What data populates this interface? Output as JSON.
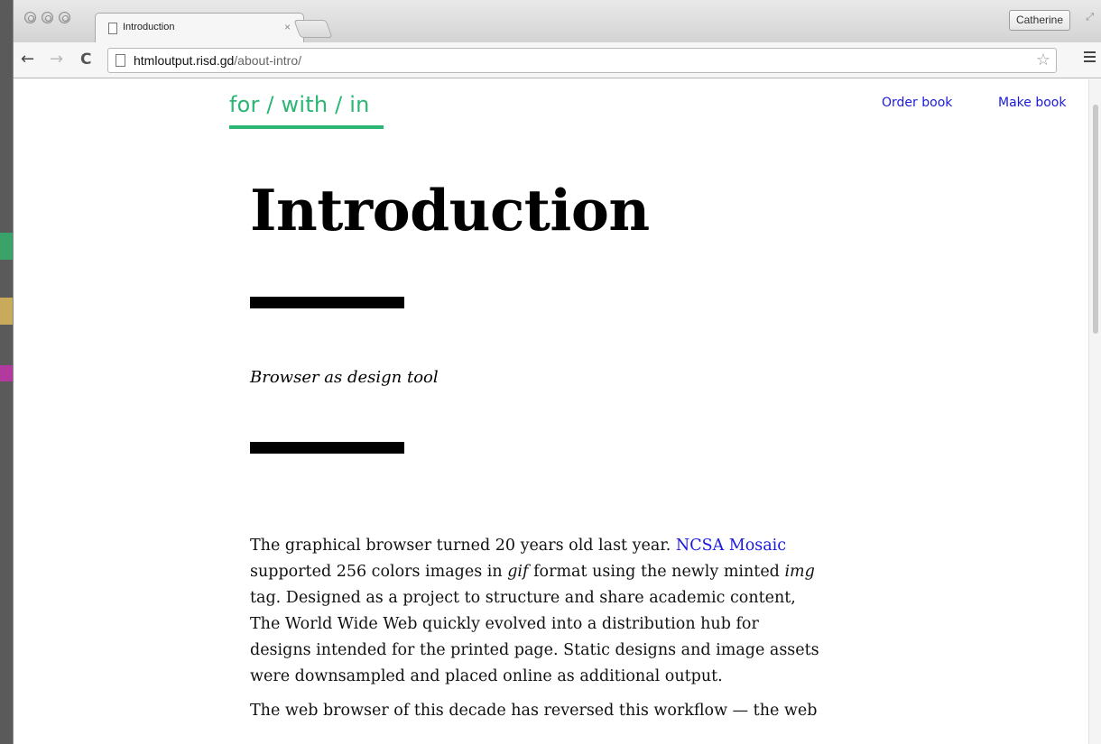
{
  "browser": {
    "tab_title": "Introduction",
    "tab_close": "×",
    "profile_name": "Catherine",
    "url_host": "htmloutput.risd.gd",
    "url_path": "/about-intro/"
  },
  "site": {
    "logo": "for / with / in",
    "nav": {
      "order": "Order book",
      "make": "Make book"
    }
  },
  "article": {
    "title": "Introduction",
    "subtitle": "Browser as design tool",
    "p1": {
      "a": "The graphical browser turned 20 years old last year. ",
      "link": "NCSA Mosaic",
      "b": "supported 256 colors images in ",
      "gif": "gif",
      "c": " format using the newly minted ",
      "img": "img",
      "d": "tag. Designed as a project to structure and share academic content,",
      "e": "The World Wide Web quickly evolved into a distribution hub for",
      "f": "designs intended for the printed page. Static designs and image assets",
      "g": "were downsampled and placed online as additional output."
    },
    "p2": "The web browser of this decade has reversed this workflow — the web"
  },
  "colors": {
    "accent_green": "#2bb673",
    "link_blue": "#1a1adb"
  }
}
